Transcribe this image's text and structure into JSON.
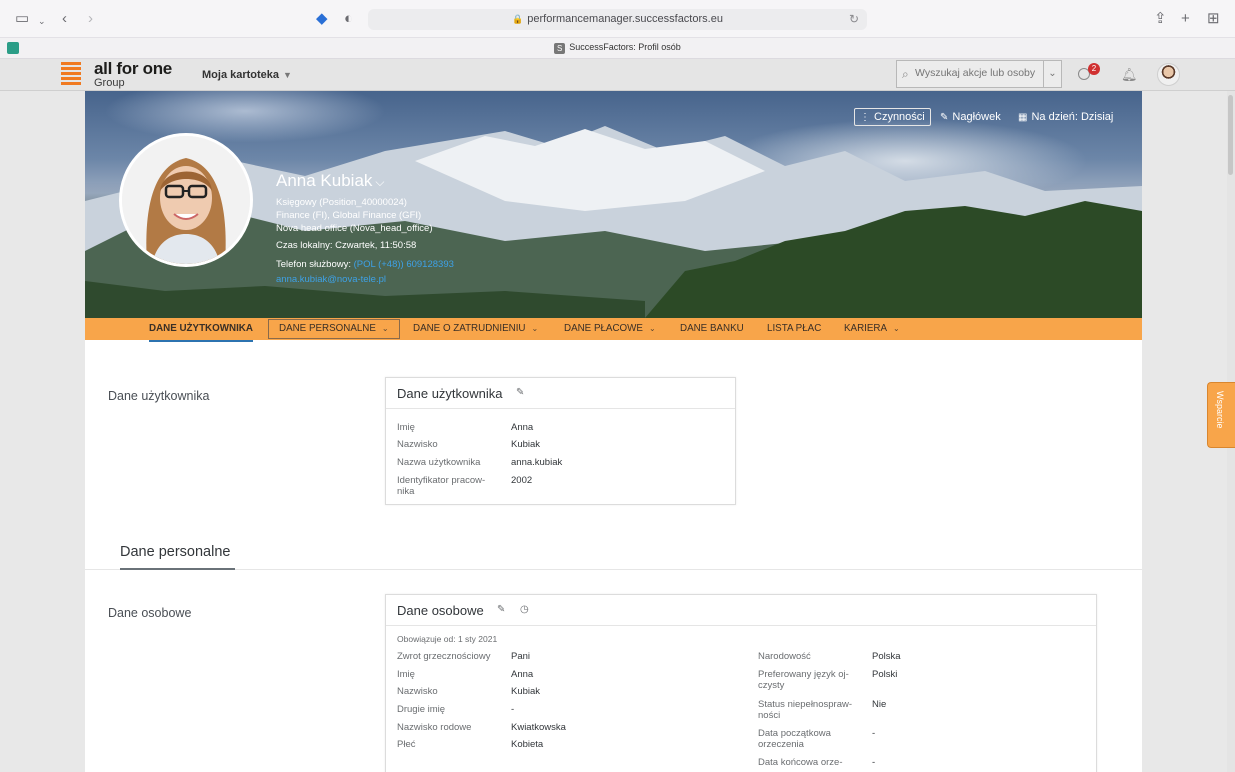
{
  "browser": {
    "url": "performancemanager.successfactors.eu",
    "tab_title": "SuccessFactors: Profil osób",
    "tab_favicon": "S"
  },
  "shell": {
    "logo_text": "all for one",
    "logo_sub": "Group",
    "menu_label": "Moja kartoteka",
    "search_placeholder": "Wyszukaj akcje lub osoby",
    "todo_badge": "2"
  },
  "header": {
    "actions": {
      "czynnosci": "Czynności",
      "naglowek": "Nagłówek",
      "na_dzien": "Na dzień: Dzisiaj"
    },
    "name": "Anna Kubiak",
    "position": "Księgowy (Position_40000024)",
    "department": "Finance (FI), Global Finance (GFI)",
    "location": "Nova head office (Nova_head_office)",
    "local_time": "Czas lokalny: Czwartek, 11:50:58",
    "phone_label": "Telefon służbowy:",
    "phone_value": "(POL (+48)) 609128393",
    "email": "anna.kubiak@nova-tele.pl"
  },
  "nav": {
    "items": [
      {
        "label": "DANE UŻYTKOWNIKA"
      },
      {
        "label": "DANE PERSONALNE"
      },
      {
        "label": "DANE O ZATRUDNIENIU"
      },
      {
        "label": "DANE PŁACOWE"
      },
      {
        "label": "DANE BANKU"
      },
      {
        "label": "LISTA PŁAC"
      },
      {
        "label": "KARIERA"
      }
    ]
  },
  "user_section": {
    "label": "Dane użytkownika",
    "card_title": "Dane użytkownika",
    "fields": [
      {
        "label": "Imię",
        "value": "Anna"
      },
      {
        "label": "Nazwisko",
        "value": "Kubiak"
      },
      {
        "label": "Nazwa użytkownika",
        "value": "anna.kubiak"
      },
      {
        "label": "Identyfikator pracow-",
        "label2": "nika",
        "value": "2002"
      }
    ]
  },
  "personal": {
    "subheading": "Dane personalne",
    "label": "Dane osobowe",
    "card_title": "Dane osobowe",
    "valid_from": "Obowiązuje od: 1 sty 2021",
    "left_fields": [
      {
        "label": "Zwrot grzecznościowy",
        "value": "Pani"
      },
      {
        "label": "Imię",
        "value": "Anna"
      },
      {
        "label": "Nazwisko",
        "value": "Kubiak"
      },
      {
        "label": "Drugie imię",
        "value": "-"
      },
      {
        "label": "Nazwisko rodowe",
        "value": "Kwiatkowska"
      },
      {
        "label": "Płeć",
        "value": "Kobieta"
      }
    ],
    "right_fields": [
      {
        "label": "Narodowość",
        "value": "Polska"
      },
      {
        "label": "Preferowany język oj-",
        "label2": "czysty",
        "value": "Polski"
      },
      {
        "label": "Status niepełnospraw-",
        "label2": "ności",
        "value": "Nie"
      },
      {
        "label": "Data początkowa",
        "label2": "orzeczenia",
        "value": "-"
      },
      {
        "label": "Data końcowa orze-",
        "value": "-"
      }
    ]
  },
  "support_tab": "Wsparcie"
}
